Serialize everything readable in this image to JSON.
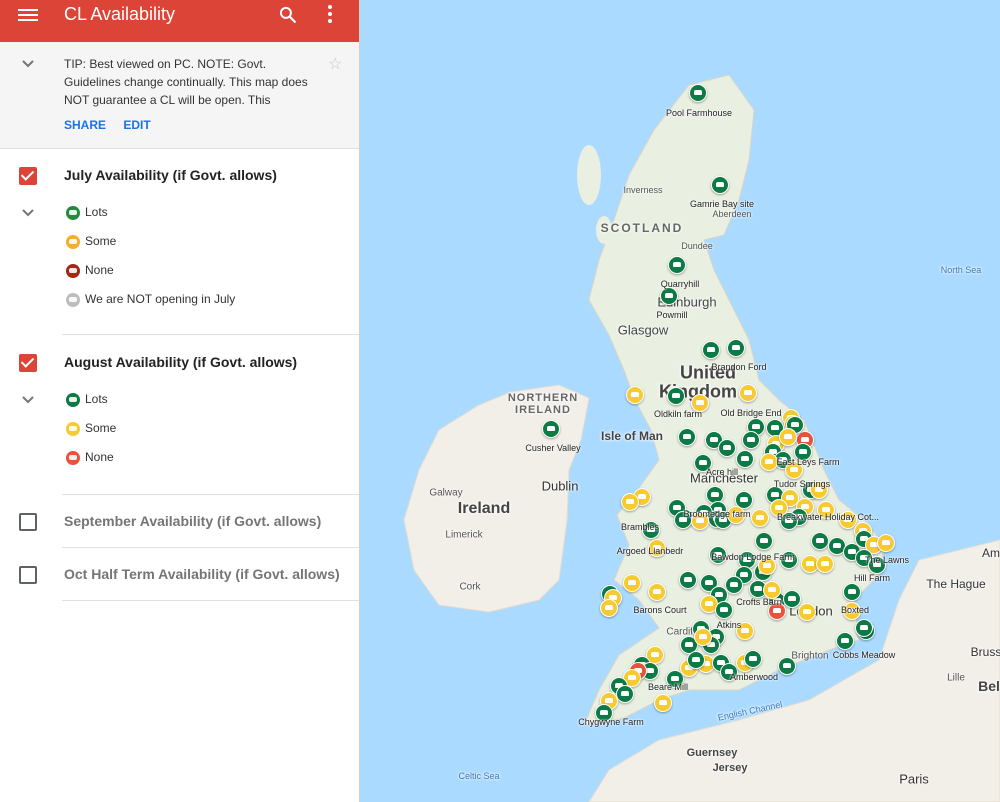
{
  "app": {
    "title": "CL Availability"
  },
  "tip": {
    "text": "TIP: Best viewed on PC. NOTE: Govt. Guidelines change continually. This map does NOT guarantee a CL will be open. This",
    "share": "SHARE",
    "edit": "EDIT"
  },
  "layers": [
    {
      "name": "July Availability (if Govt. allows)",
      "checked": true,
      "legend": [
        {
          "label": "Lots",
          "color": "#1e8e3e"
        },
        {
          "label": "Some",
          "color": "#f6ae2d"
        },
        {
          "label": "None",
          "color": "#a52714"
        },
        {
          "label": "We are NOT opening in July",
          "color": "#bdbdbd"
        }
      ]
    },
    {
      "name": "August Availability (if Govt. allows)",
      "checked": true,
      "legend": [
        {
          "label": "Lots",
          "color": "#0b7a45"
        },
        {
          "label": "Some",
          "color": "#f7cb2f"
        },
        {
          "label": "None",
          "color": "#e8533a"
        }
      ]
    },
    {
      "name": "September Availability (if Govt. allows)",
      "checked": false
    },
    {
      "name": "Oct Half Term Availability (if Govt. allows)",
      "checked": false
    }
  ],
  "map": {
    "colors": {
      "sea": "#aadaff",
      "land": "#f2efe9",
      "green_pin": "#0b7a45",
      "yellow_pin": "#f7cb2f",
      "red_pin": "#e8533a"
    },
    "place_labels": {
      "scotland": "SCOTLAND",
      "northern_ireland_1": "NORTHERN",
      "northern_ireland_2": "IRELAND",
      "ireland": "Ireland",
      "uk_1": "United",
      "uk_2": "Kingdom",
      "north_sea": "North Sea",
      "isle_of_man": "Isle of Man",
      "english_channel": "English Channel",
      "celtic_sea": "Celtic Sea",
      "inverness": "Inverness",
      "aberdeen": "Aberdeen",
      "dundee": "Dundee",
      "edinburgh": "Edinburgh",
      "glasgow": "Glasgow",
      "dublin": "Dublin",
      "galway": "Galway",
      "limerick": "Limerick",
      "cork": "Cork",
      "manchester": "Manchester",
      "london": "London",
      "cardiff": "Cardiff",
      "brighton": "Brighton",
      "the_hague": "The Hague",
      "paris": "Paris",
      "guernsey": "Guernsey",
      "jersey": "Jersey",
      "lille": "Lille",
      "brussels": "Bruss",
      "belgium": "Bel",
      "amsterdam": "Am"
    },
    "site_labels": [
      "Pool Farmhouse",
      "Gamrie Bay site",
      "Quarryhill",
      "Powmill",
      "Brandon Ford",
      "Oldkiln farm",
      "Old Bridge End",
      "Cusher Valley",
      "East Leys Farm",
      "Acre hill",
      "Tudor Springs",
      "Broomedge farm",
      "Breakwater Holiday Cot...",
      "Brambles",
      "Argoed Llanbedr",
      "Bawdon Lodge Farm",
      "The Lawns",
      "Hill Farm",
      "Crofts Barn",
      "Barons Court",
      "Boxted",
      "Atkins",
      "Cobbs Meadow",
      "Amberwood",
      "Beare Mill",
      "Chygwyne Farm"
    ]
  }
}
